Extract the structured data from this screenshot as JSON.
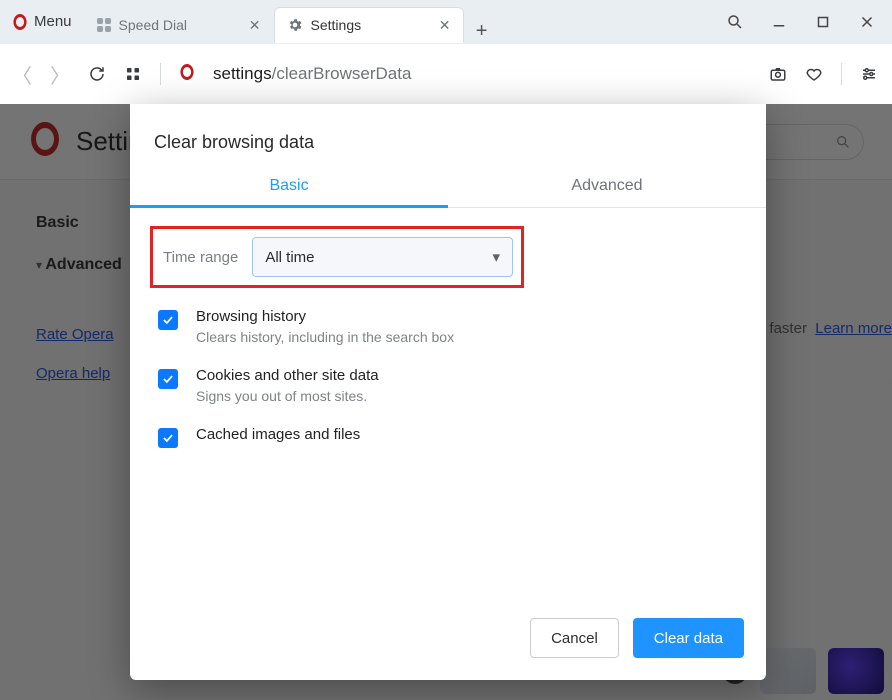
{
  "window": {
    "menu_label": "Menu",
    "tabs": [
      {
        "label": "Speed Dial",
        "icon": "speed-dial-icon"
      },
      {
        "label": "Settings",
        "icon": "gear-icon"
      }
    ]
  },
  "toolbar": {
    "url_prefix": "settings",
    "url_path": "/clearBrowserData"
  },
  "settings_page": {
    "title": "Settings",
    "sidebar": {
      "items": [
        "Basic",
        "Advanced"
      ],
      "links": [
        "Rate Opera",
        "Opera help"
      ]
    },
    "promo_text": "faster",
    "promo_link": "Learn more"
  },
  "dialog": {
    "title": "Clear browsing data",
    "tabs": [
      "Basic",
      "Advanced"
    ],
    "time_range_label": "Time range",
    "time_range_value": "All time",
    "options": [
      {
        "title": "Browsing history",
        "sub": "Clears history, including in the search box",
        "checked": true
      },
      {
        "title": "Cookies and other site data",
        "sub": "Signs you out of most sites.",
        "checked": true
      },
      {
        "title": "Cached images and files",
        "sub": "",
        "checked": true
      }
    ],
    "cancel_label": "Cancel",
    "confirm_label": "Clear data"
  }
}
